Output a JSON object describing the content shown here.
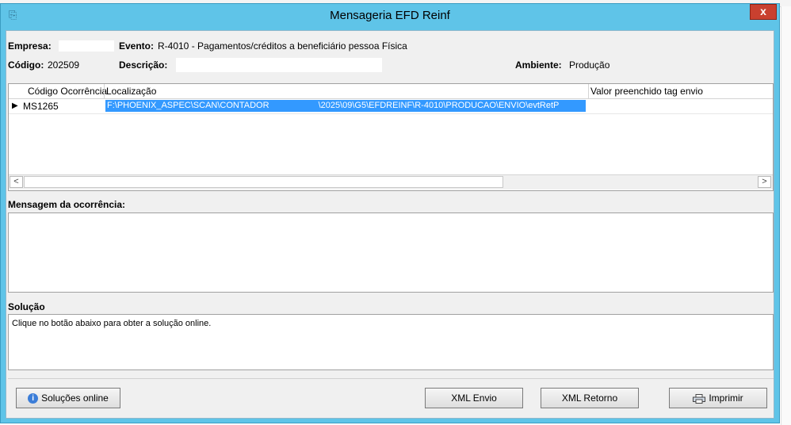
{
  "window": {
    "title": "Mensageria EFD Reinf",
    "close_label": "x"
  },
  "header": {
    "empresa_label": "Empresa:",
    "evento_label": "Evento:",
    "evento_value": "R-4010 - Pagamentos/créditos a beneficiário pessoa Física",
    "codigo_label": "Código:",
    "codigo_value": "202509",
    "descricao_label": "Descrição:",
    "ambiente_label": "Ambiente:",
    "ambiente_value": "Produção"
  },
  "grid": {
    "columns": [
      "Código Ocorrência",
      "Localização",
      "Valor preenchido tag envio"
    ],
    "rows": [
      {
        "codigo": "MS1265",
        "localizacao_part1": "F:\\PHOENIX_ASPEC\\SCAN\\CONTADOR",
        "localizacao_part2": "\\2025\\09\\G5\\EFDREINF\\R-4010\\PRODUCAO\\ENVIO\\evtRetP",
        "valor": ""
      }
    ],
    "scroll_left": "<",
    "scroll_right": ">"
  },
  "mensagem": {
    "title": "Mensagem da ocorrência:",
    "text": ""
  },
  "solucao": {
    "title": "Solução",
    "text": "Clique no botão abaixo para obter a solução online."
  },
  "buttons": {
    "solucoes_online": "Soluções online",
    "xml_envio": "XML Envio",
    "xml_retorno": "XML Retorno",
    "imprimir": "Imprimir"
  },
  "colors": {
    "window_frame": "#5fc4e8",
    "close_button": "#c9402f",
    "selection": "#3399ff"
  }
}
